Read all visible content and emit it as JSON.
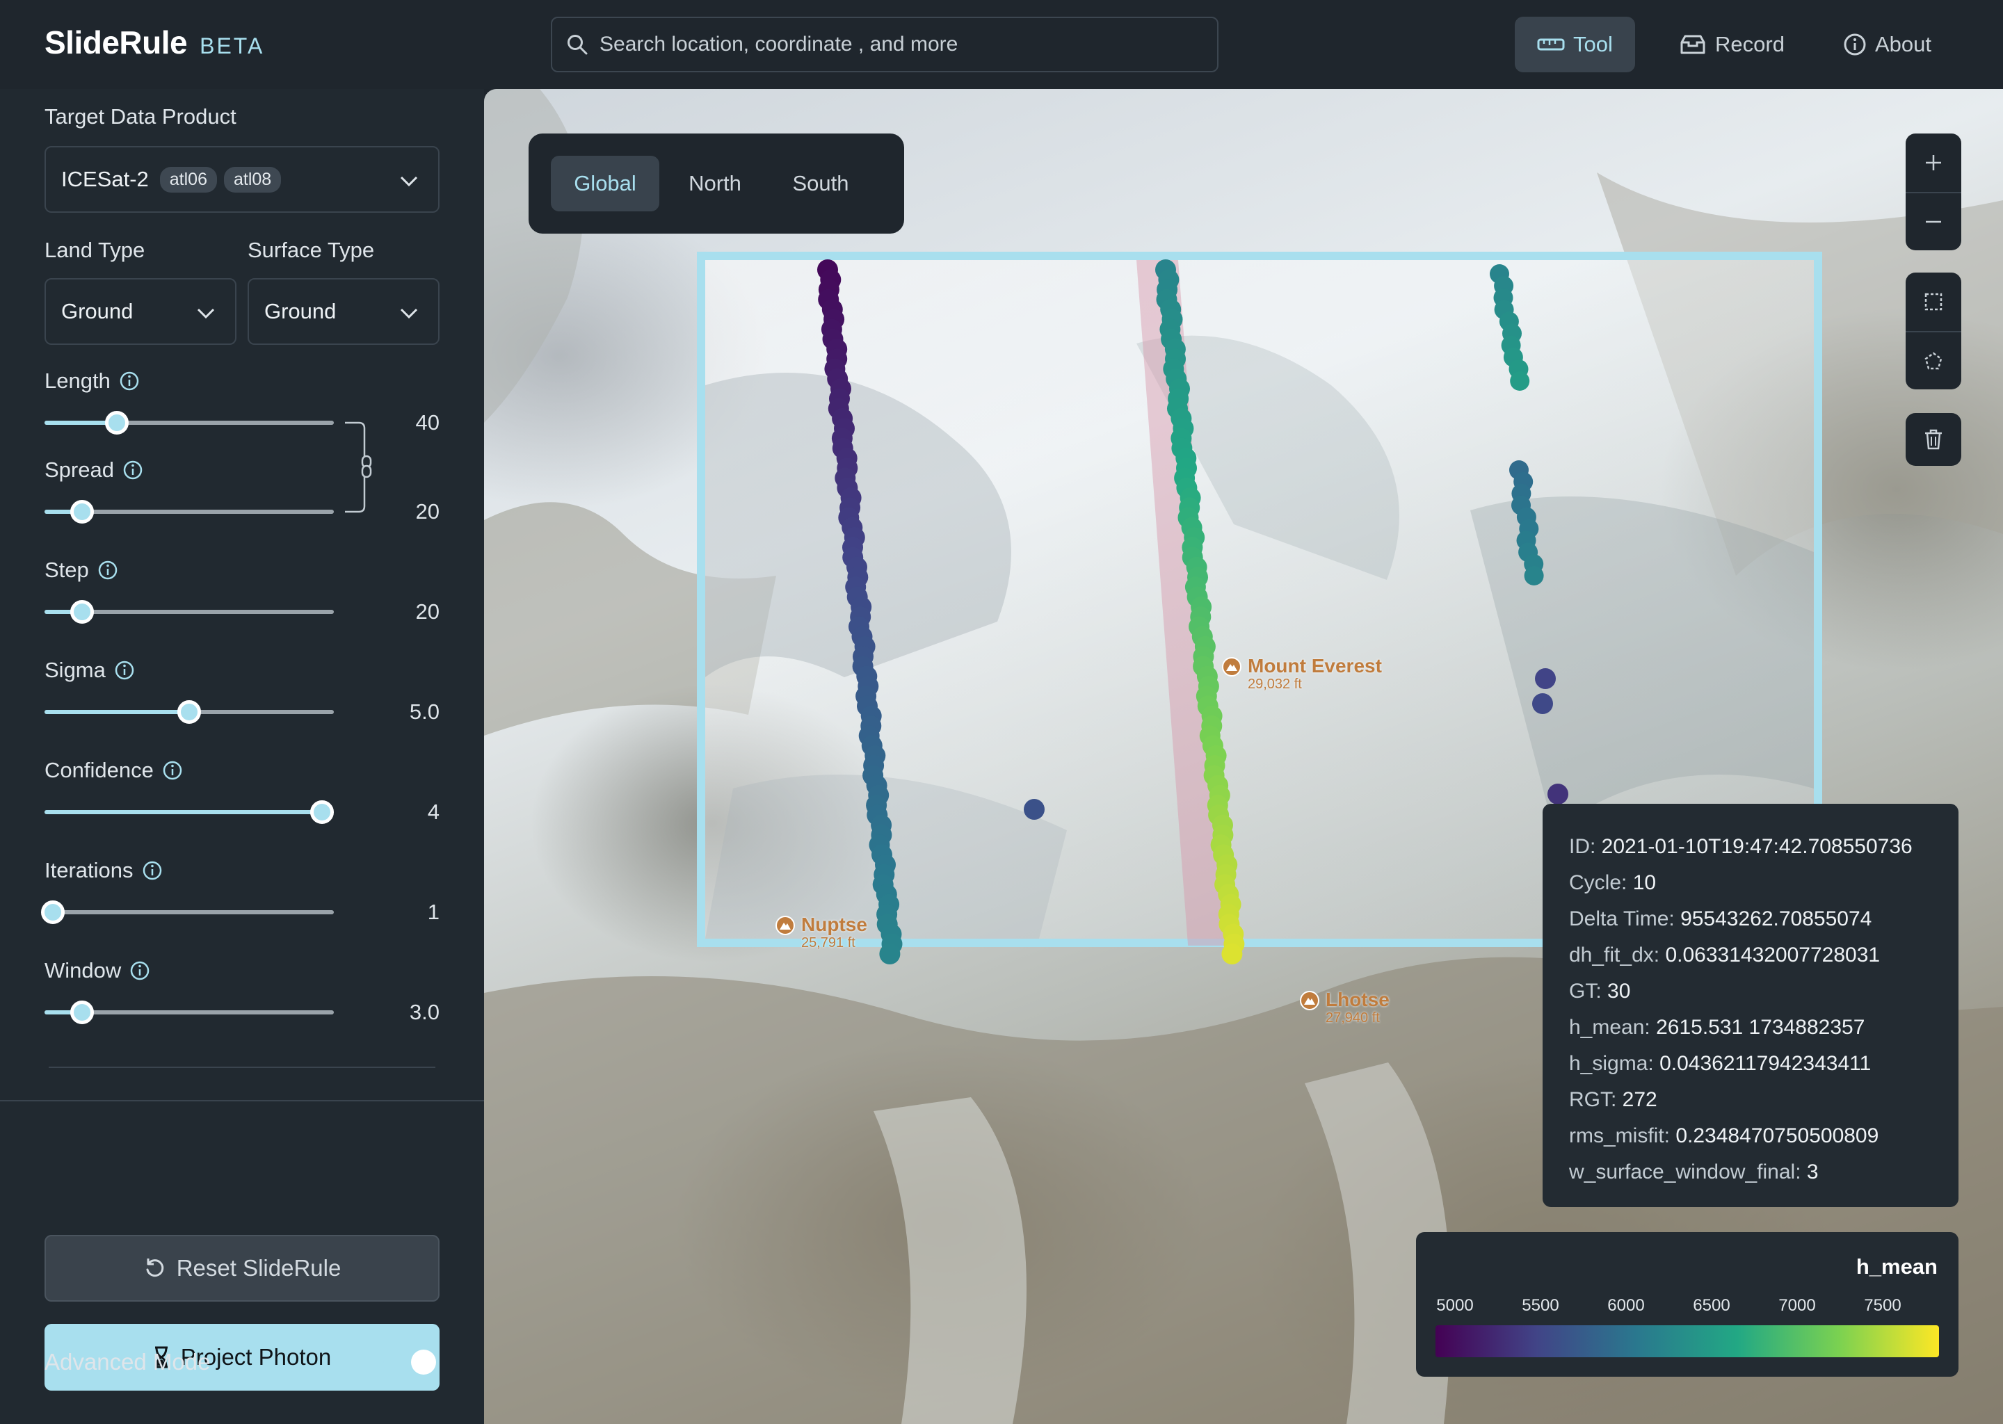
{
  "app": {
    "name": "SlideRule",
    "badge": "BETA"
  },
  "search": {
    "placeholder": "Search location, coordinate , and more"
  },
  "nav": {
    "tool": "Tool",
    "record": "Record",
    "about": "About"
  },
  "sidebar": {
    "target_label": "Target Data Product",
    "target_value": "ICESat-2",
    "target_tags": [
      "atl06",
      "atl08"
    ],
    "land_type_label": "Land Type",
    "land_type_value": "Ground",
    "surface_type_label": "Surface Type",
    "surface_type_value": "Ground",
    "sliders": [
      {
        "label": "Length",
        "value": "40",
        "fraction": 0.25
      },
      {
        "label": "Spread",
        "value": "20",
        "fraction": 0.13
      },
      {
        "label": "Step",
        "value": "20",
        "fraction": 0.13
      },
      {
        "label": "Sigma",
        "value": "5.0",
        "fraction": 0.5
      },
      {
        "label": "Confidence",
        "value": "4",
        "fraction": 0.96
      },
      {
        "label": "Iterations",
        "value": "1",
        "fraction": 0.03
      },
      {
        "label": "Window",
        "value": "3.0",
        "fraction": 0.13
      }
    ],
    "reset_label": "Reset SlideRule",
    "project_label": "Project Photon",
    "advanced_label": "Advanced Mode",
    "advanced_on": true
  },
  "map": {
    "projections": [
      "Global",
      "North",
      "South"
    ],
    "active_projection": "Global",
    "peaks": [
      {
        "name": "Mount Everest",
        "elevation": "29,032 ft"
      },
      {
        "name": "Nuptse",
        "elevation": "25,791 ft"
      },
      {
        "name": "Lhotse",
        "elevation": "27,940 ft"
      }
    ],
    "popup": [
      {
        "key": "ID",
        "value": "2021-01-10T19:47:42.708550736"
      },
      {
        "key": "Cycle",
        "value": "10"
      },
      {
        "key": "Delta Time",
        "value": "95543262.70855074"
      },
      {
        "key": "dh_fit_dx",
        "value": "0.06331432007728031"
      },
      {
        "key": "GT",
        "value": "30"
      },
      {
        "key": "h_mean",
        "value": "2615.531 1734882357"
      },
      {
        "key": "h_sigma",
        "value": "0.04362117942343411"
      },
      {
        "key": "RGT",
        "value": "272"
      },
      {
        "key": "rms_misfit",
        "value": "0.2348470750500809"
      },
      {
        "key": "w_surface_window_final",
        "value": "3"
      }
    ],
    "legend": {
      "title": "h_mean",
      "ticks": [
        "5000",
        "5500",
        "6000",
        "6500",
        "7000",
        "7500"
      ],
      "colors": [
        "#440154",
        "#414487",
        "#2a788e",
        "#22a884",
        "#7ad151",
        "#fde725"
      ]
    }
  }
}
